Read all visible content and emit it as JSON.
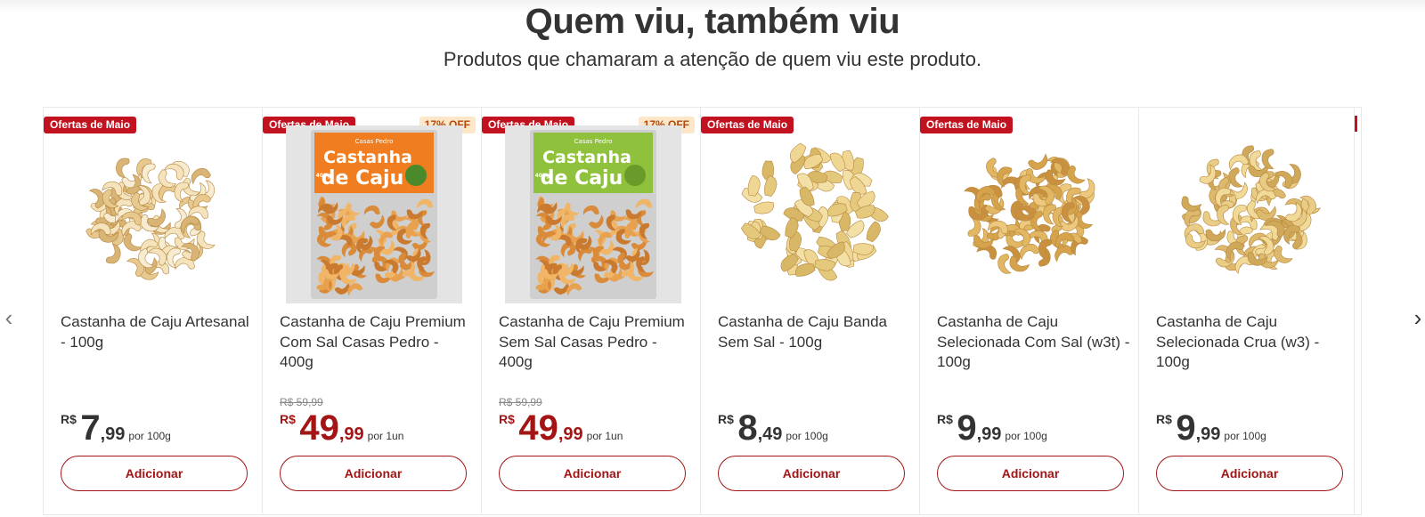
{
  "section": {
    "title": "Quem viu, também viu",
    "subtitle": "Produtos que chamaram a atenção de quem viu este produto."
  },
  "nav": {
    "prev_icon": "chevron-left-icon",
    "next_icon": "chevron-right-icon",
    "prev_glyph": "‹",
    "next_glyph": "›"
  },
  "colors": {
    "brand_red": "#c3121f",
    "price_sale": "#a31515",
    "discount_bg": "#fde7c8",
    "discount_text": "#b5480f"
  },
  "products": [
    {
      "badge": "Ofertas de Maio",
      "discount": "",
      "name": "Castanha de Caju Artesanal - 100g",
      "old_price": "",
      "currency": "R$",
      "price_int": "7",
      "price_dec": ",99",
      "unit": "por 100g",
      "on_sale": false,
      "image": "cashew-pile-roasted-image",
      "button": "Adicionar"
    },
    {
      "badge": "Ofertas de Maio",
      "discount": "17% OFF",
      "name": "Castanha de Caju Premium Com Sal Casas Pedro - 400g",
      "old_price": "R$ 59,99",
      "currency": "R$",
      "price_int": "49",
      "price_dec": ",99",
      "unit": "por 1un",
      "on_sale": true,
      "image": "cashew-package-orange-image",
      "package_brand": "Casas Pedro",
      "package_title_1": "Castanha",
      "package_title_2": "de Caju",
      "package_weight": "400g",
      "button": "Adicionar"
    },
    {
      "badge": "Ofertas de Maio",
      "discount": "17% OFF",
      "name": "Castanha de Caju Premium Sem Sal Casas Pedro - 400g",
      "old_price": "R$ 59,99",
      "currency": "R$",
      "price_int": "49",
      "price_dec": ",99",
      "unit": "por 1un",
      "on_sale": true,
      "image": "cashew-package-green-image",
      "package_brand": "Casas Pedro",
      "package_title_1": "Castanha",
      "package_title_2": "de Caju",
      "package_weight": "400g",
      "button": "Adicionar"
    },
    {
      "badge": "Ofertas de Maio",
      "discount": "",
      "name": "Castanha de Caju Banda Sem Sal - 100g",
      "old_price": "",
      "currency": "R$",
      "price_int": "8",
      "price_dec": ",49",
      "unit": "por 100g",
      "on_sale": false,
      "image": "cashew-halves-pile-image",
      "button": "Adicionar"
    },
    {
      "badge": "Ofertas de Maio",
      "discount": "",
      "name": "Castanha de Caju Selecionada Com Sal (w3t) - 100g",
      "old_price": "",
      "currency": "R$",
      "price_int": "9",
      "price_dec": ",99",
      "unit": "por 100g",
      "on_sale": false,
      "image": "cashew-pile-salted-image",
      "button": "Adicionar"
    },
    {
      "badge": "",
      "discount": "",
      "name": "Castanha de Caju Selecionada Crua (w3) - 100g",
      "old_price": "",
      "currency": "R$",
      "price_int": "9",
      "price_dec": ",99",
      "unit": "por 100g",
      "on_sale": false,
      "image": "cashew-pile-raw-image",
      "button": "Adicionar"
    }
  ]
}
